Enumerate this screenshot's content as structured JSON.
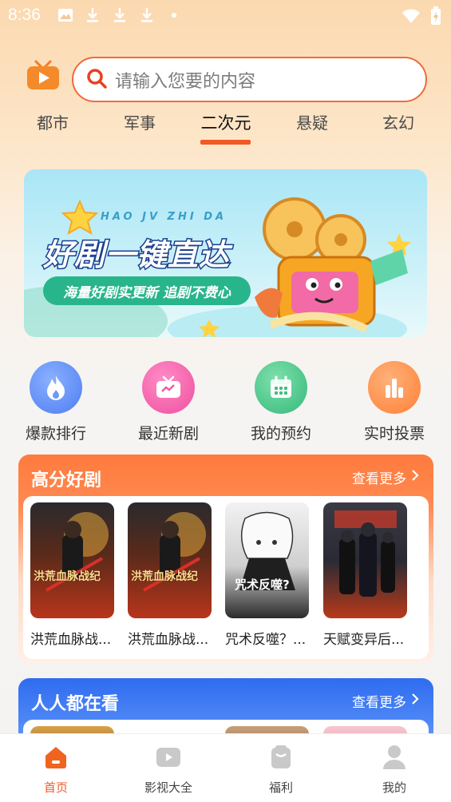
{
  "status_bar": {
    "time": "8:36",
    "icons": [
      "image-icon",
      "download-icon",
      "download-icon",
      "download-icon",
      "dot-icon"
    ],
    "right_icons": [
      "wifi-icon",
      "battery-icon"
    ]
  },
  "header": {
    "logo": "tv-logo-icon",
    "search": {
      "placeholder": "请输入您要的内容",
      "icon": "search-icon"
    }
  },
  "tabs": [
    {
      "label": "都市",
      "active": false
    },
    {
      "label": "军事",
      "active": false
    },
    {
      "label": "二次元",
      "active": true
    },
    {
      "label": "悬疑",
      "active": false
    },
    {
      "label": "玄幻",
      "active": false
    }
  ],
  "banner": {
    "subtitle": "HAO JV ZHI DA",
    "title": "好剧一键直达",
    "tagline": "海量好剧实更新 追剧不费心"
  },
  "quick_nav": [
    {
      "label": "爆款排行",
      "icon": "fire-icon",
      "color": "#5b8cf6"
    },
    {
      "label": "最近新剧",
      "icon": "tv-icon",
      "color": "#f05ca8"
    },
    {
      "label": "我的预约",
      "icon": "calendar-icon",
      "color": "#3fbf7f"
    },
    {
      "label": "实时投票",
      "icon": "bar-chart-icon",
      "color": "#ff8a48"
    }
  ],
  "sections": [
    {
      "title": "高分好剧",
      "more": "查看更多",
      "items": [
        {
          "title": "洪荒血脉战...",
          "poster_text": "洪荒血脉战纪"
        },
        {
          "title": "洪荒血脉战...",
          "poster_text": "洪荒血脉战纪"
        },
        {
          "title": "咒术反噬？...",
          "poster_text": "咒术反噬?"
        },
        {
          "title": "天赋变异后..."
        }
      ]
    },
    {
      "title": "人人都在看",
      "more": "查看更多"
    }
  ],
  "bottom_nav": [
    {
      "label": "首页",
      "icon": "home-icon",
      "active": true
    },
    {
      "label": "影视大全",
      "icon": "video-icon",
      "active": false
    },
    {
      "label": "福利",
      "icon": "gift-icon",
      "active": false
    },
    {
      "label": "我的",
      "icon": "user-icon",
      "active": false
    }
  ],
  "colors": {
    "accent": "#f05a23",
    "search_border": "#f06a3c",
    "section1": "#ff7a3d",
    "section2": "#2f6cf0"
  }
}
